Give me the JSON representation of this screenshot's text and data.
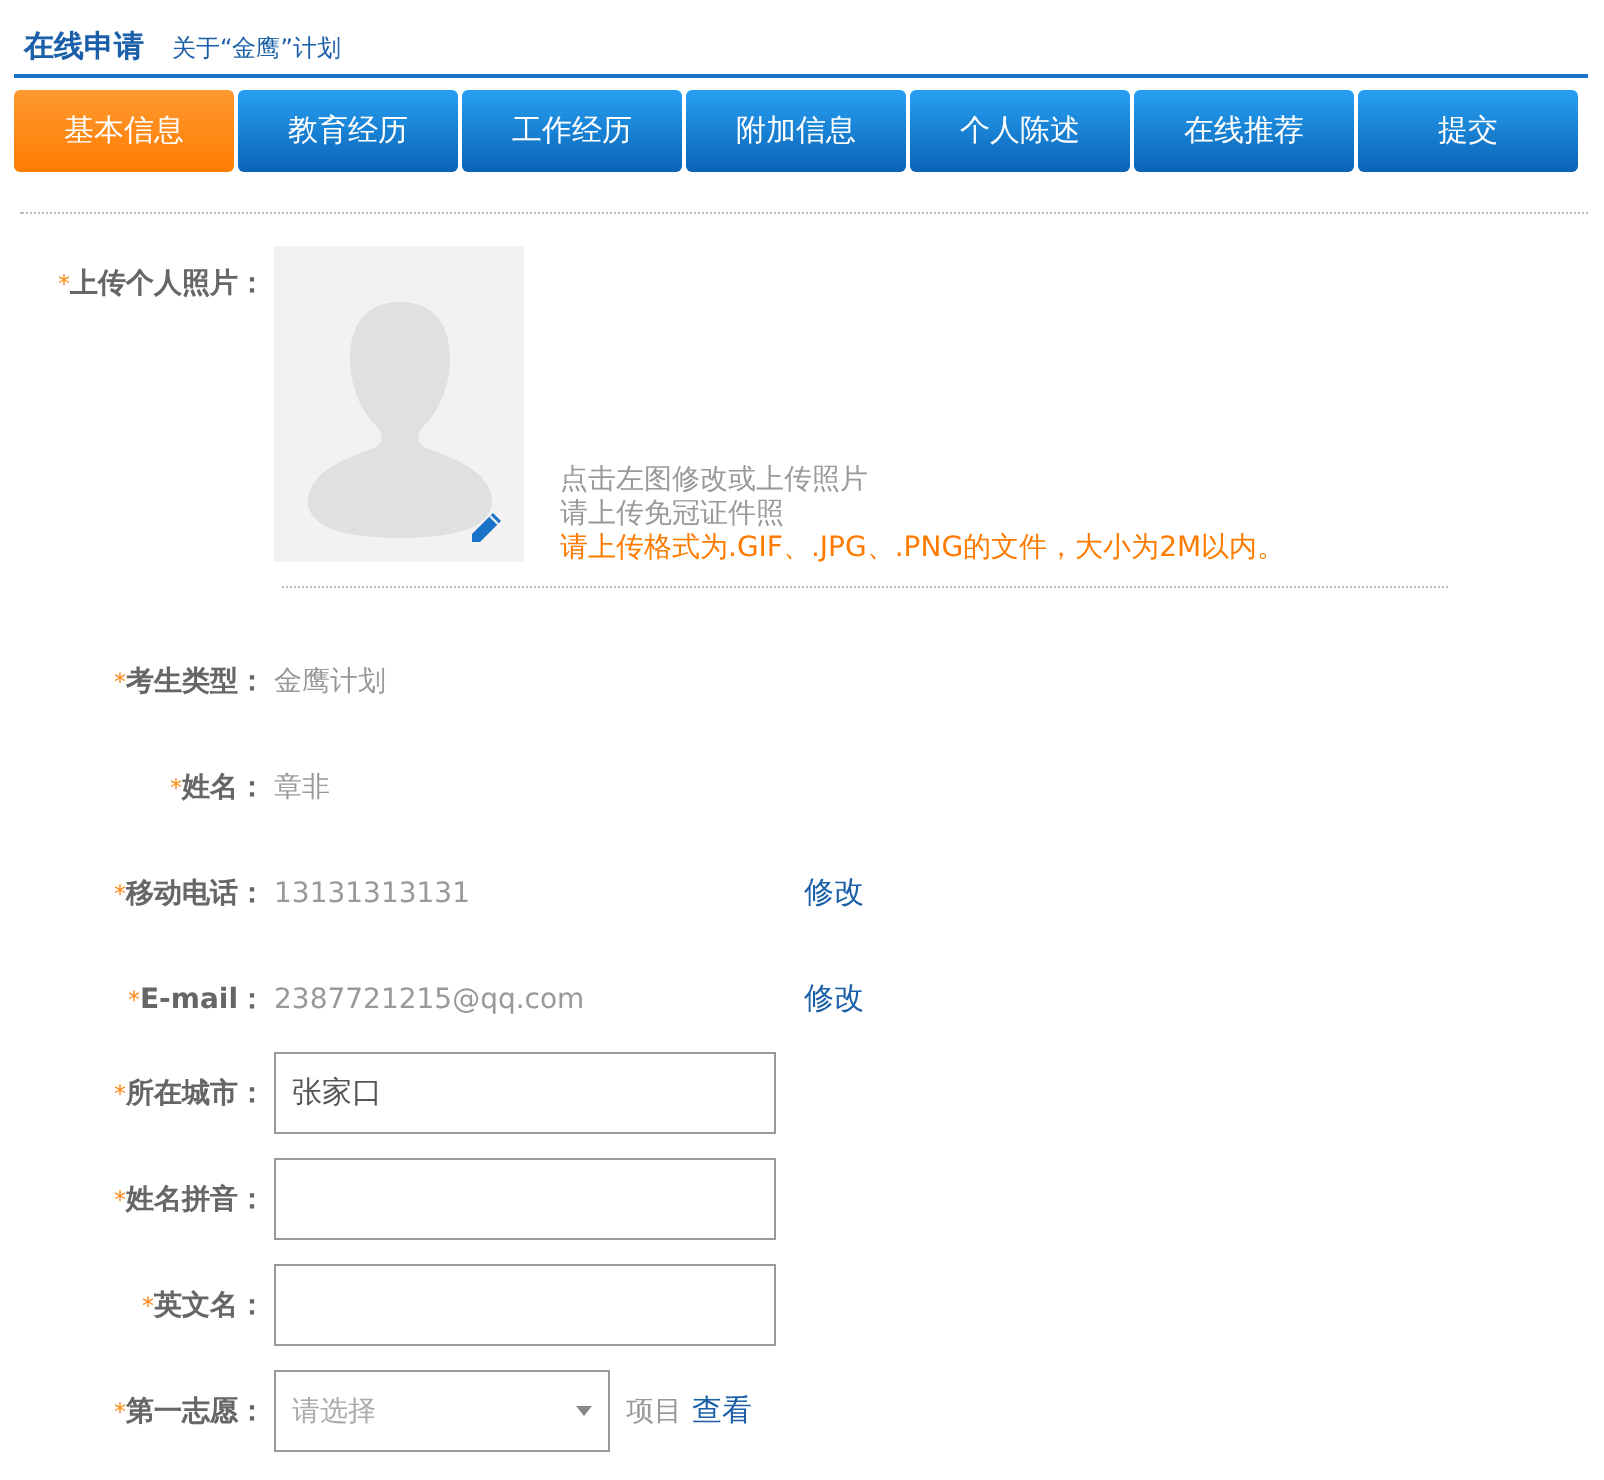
{
  "header": {
    "title": "在线申请",
    "subtitle": "关于“金鹰”计划"
  },
  "tabs": [
    {
      "label": "基本信息",
      "selected": true
    },
    {
      "label": "教育经历",
      "selected": false
    },
    {
      "label": "工作经历",
      "selected": false
    },
    {
      "label": "附加信息",
      "selected": false
    },
    {
      "label": "个人陈述",
      "selected": false
    },
    {
      "label": "在线推荐",
      "selected": false
    },
    {
      "label": "提交",
      "selected": false
    }
  ],
  "photo": {
    "mark": "*",
    "label": "上传个人照片：",
    "hints": [
      "点击左图修改或上传照片",
      "请上传免冠证件照"
    ],
    "warning": "请上传格式为.GIF、.JPG、.PNG的文件，大小为2M以内。"
  },
  "fields": [
    {
      "kind": "static",
      "mark": "*",
      "label": "考生类型：",
      "value": "金鹰计划"
    },
    {
      "kind": "static",
      "mark": "*",
      "label": "姓名：",
      "value": "章非"
    },
    {
      "kind": "static_edit",
      "mark": "*",
      "label": "移动电话：",
      "value": "13131313131",
      "action": "修改"
    },
    {
      "kind": "static_edit",
      "mark": "*",
      "label": "E-mail：",
      "value": "2387721215@qq.com",
      "action": "修改"
    },
    {
      "kind": "input",
      "mark": "*",
      "label": "所在城市：",
      "value": "张家口"
    },
    {
      "kind": "input",
      "mark": "*",
      "label": "姓名拼音："
    },
    {
      "kind": "input",
      "mark": "*",
      "label": "英文名："
    },
    {
      "kind": "select",
      "mark": "*",
      "label": "第一志愿：",
      "placeholder": "请选择",
      "suffix": "项目",
      "action": "查看"
    }
  ]
}
